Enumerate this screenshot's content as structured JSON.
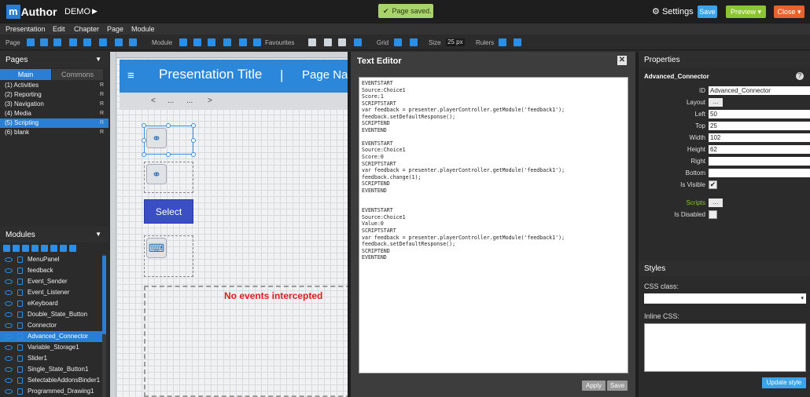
{
  "topbar": {
    "logo_prefix": "m",
    "logo_name": "Author",
    "project": "DEMO",
    "project_arrow": "▶",
    "toast": "Page saved.",
    "settings": "Settings",
    "save": "Save",
    "preview": "Preview",
    "close": "Close",
    "dropdown_glyph": "▾"
  },
  "menu": {
    "presentation": "Presentation",
    "edit": "Edit",
    "chapter": "Chapter",
    "page": "Page",
    "module": "Module"
  },
  "toolbar": {
    "page": "Page",
    "module": "Module",
    "favourites": "Favourites",
    "grid": "Grid",
    "size": "Size",
    "size_value": "25 px",
    "rulers": "Rulers"
  },
  "pages_panel": {
    "title": "Pages",
    "tab_main": "Main",
    "tab_common": "Commons",
    "items": [
      {
        "label": "(1) Activities",
        "flag": "R"
      },
      {
        "label": "(2) Reporting",
        "flag": "R"
      },
      {
        "label": "(3) Navigation",
        "flag": "R"
      },
      {
        "label": "(4) Media",
        "flag": "R"
      },
      {
        "label": "(5) Scripting",
        "flag": "R"
      },
      {
        "label": "(6) blank",
        "flag": "R"
      }
    ],
    "selected_index": 4
  },
  "modules_panel": {
    "title": "Modules",
    "items": [
      "MenuPanel",
      "feedback",
      "Event_Sender",
      "Event_Listener",
      "eKeyboard",
      "Double_State_Button",
      "Connector",
      "Advanced_Connector",
      "Variable_Storage1",
      "Slider1",
      "Single_State_Button1",
      "SelectableAddonsBinder1",
      "Programmed_Drawing1"
    ],
    "selected_index": 7
  },
  "canvas": {
    "presentation_title": "Presentation Title",
    "separator": "|",
    "page_name": "Page Name",
    "breadcrumb": [
      "<",
      "...",
      "...",
      ">"
    ],
    "select_button": "Select",
    "events_text": "No events intercepted",
    "menu_glyph": "≡",
    "link_glyph": "⚭",
    "keyboard_glyph": "⌨"
  },
  "editor": {
    "title": "Text Editor",
    "close": "✕",
    "content": "EVENTSTART\nSource:Choice1\nScore:1\nSCRIPTSTART\nvar feedback = presenter.playerController.getModule('feedback1');\nfeedback.setDefaultResponse();\nSCRIPTEND\nEVENTEND\n\nEVENTSTART\nSource:Choice1\nScore:0\nSCRIPTSTART\nvar feedback = presenter.playerController.getModule('feedback1');\nfeedback.change(1);\nSCRIPTEND\nEVENTEND\n\n\nEVENTSTART\nSource:Choice1\nValue:0\nSCRIPTSTART\nvar feedback = presenter.playerController.getModule('feedback1');\nfeedback.setDefaultResponse();\nSCRIPTEND\nEVENTEND",
    "apply": "Apply",
    "save": "Save"
  },
  "properties": {
    "title": "Properties",
    "module_name": "Advanced_Connector",
    "help": "?",
    "id_label": "ID",
    "id_value": "Advanced_Connector",
    "layout_label": "Layout",
    "layout_btn": "...",
    "left_label": "Left",
    "left_value": "50",
    "top_label": "Top",
    "top_value": "25",
    "width_label": "Width",
    "width_value": "102",
    "height_label": "Height",
    "height_value": "62",
    "right_label": "Right",
    "right_value": "",
    "bottom_label": "Bottom",
    "bottom_value": "",
    "visible_label": "Is Visible",
    "visible_checked": "✔",
    "scripts_label": "Scripts",
    "scripts_btn": "...",
    "disabled_label": "Is Disabled"
  },
  "styles": {
    "title": "Styles",
    "css_class_label": "CSS class:",
    "css_class_value": "",
    "select_arrow": "▾",
    "inline_css_label": "Inline CSS:",
    "inline_css_value": "",
    "update_btn": "Update style"
  },
  "colors": {
    "accent": "#2a7fd4",
    "save": "#3ba3e8",
    "preview": "#8bc532",
    "close": "#e8632c",
    "toast": "#a9d46c",
    "select_button": "#3a4fc3",
    "events_text": "#e02020"
  }
}
